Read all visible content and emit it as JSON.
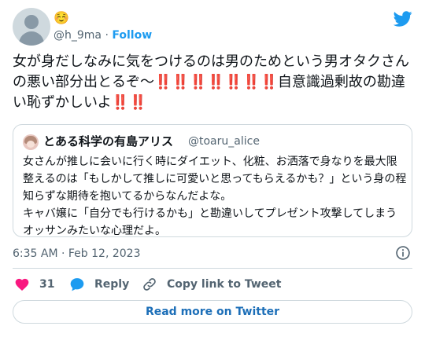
{
  "user": {
    "display_name": "☺️",
    "handle": "@h_9ma",
    "separator": "·",
    "follow_label": "Follow"
  },
  "tweet": {
    "text": "女が身だしなみに気をつけるのは男のためという男オタクさんの悪い部分出とるぞ〜‼️‼️‼️‼️‼️‼️‼️自意識過剰故の勘違い恥ずかしいよ‼️‼️",
    "timestamp": "6:35 AM · Feb 12, 2023"
  },
  "quoted": {
    "name": "とある科学の有島アリス",
    "handle": "@toaru_alice",
    "text": "女さんが推しに会いに行く時にダイエット、化粧、お洒落で身なりを最大限整えるのは「もしかして推しに可愛いと思ってもらえるかも？」という身の程知らずな期待を抱いてるからなんだよな。\nキャバ嬢に「自分でも行けるかも」と勘違いしてプレゼント攻撃してしまうオッサンみたいな心理だよ。"
  },
  "actions": {
    "likes": "31",
    "reply_label": "Reply",
    "copy_label": "Copy link to Tweet"
  },
  "read_more_label": "Read more on Twitter",
  "colors": {
    "accent": "#1d9bf0",
    "like": "#f91880",
    "text": "#0f1419",
    "muted": "#536471",
    "border": "#cfd9de"
  },
  "icons": {
    "brand": "twitter-bird-icon",
    "info": "info-icon",
    "like": "heart-icon",
    "reply": "speech-bubble-icon",
    "copy": "link-icon"
  }
}
